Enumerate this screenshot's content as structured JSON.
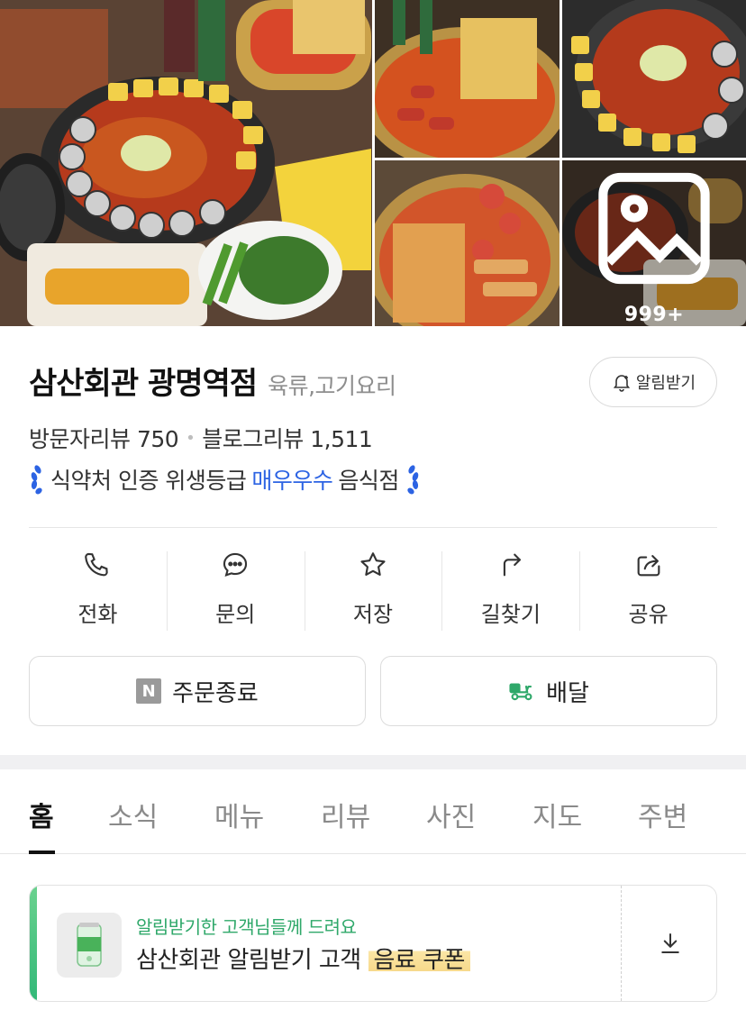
{
  "gallery": {
    "more_count": "999+",
    "icons": {
      "more": "image-icon"
    }
  },
  "place": {
    "name": "삼산회관 광명역점",
    "category": "육류,고기요리",
    "alarm_label": "알림받기",
    "visitor_reviews": "방문자리뷰 750",
    "blog_reviews": "블로그리뷰 1,511",
    "hygiene_prefix": "식약처 인증 위생등급",
    "hygiene_grade": "매우우수",
    "hygiene_suffix": "음식점"
  },
  "actions": [
    {
      "label": "전화",
      "icon": "phone-icon"
    },
    {
      "label": "문의",
      "icon": "chat-icon"
    },
    {
      "label": "저장",
      "icon": "star-icon"
    },
    {
      "label": "길찾기",
      "icon": "directions-icon"
    },
    {
      "label": "공유",
      "icon": "share-icon"
    }
  ],
  "buttons": {
    "order_badge": "N",
    "order_label": "주문종료",
    "delivery_label": "배달"
  },
  "tabs": [
    "홈",
    "소식",
    "메뉴",
    "리뷰",
    "사진",
    "지도",
    "주변"
  ],
  "coupon": {
    "subtitle": "알림받기한 고객님들께 드려요",
    "title_prefix": "삼산회관 알림받기 고객",
    "title_highlight": "음료 쿠폰"
  },
  "colors": {
    "accent_blue": "#2c63e3",
    "accent_green": "#2fa86a",
    "highlight_yellow": "#f7d98b"
  }
}
